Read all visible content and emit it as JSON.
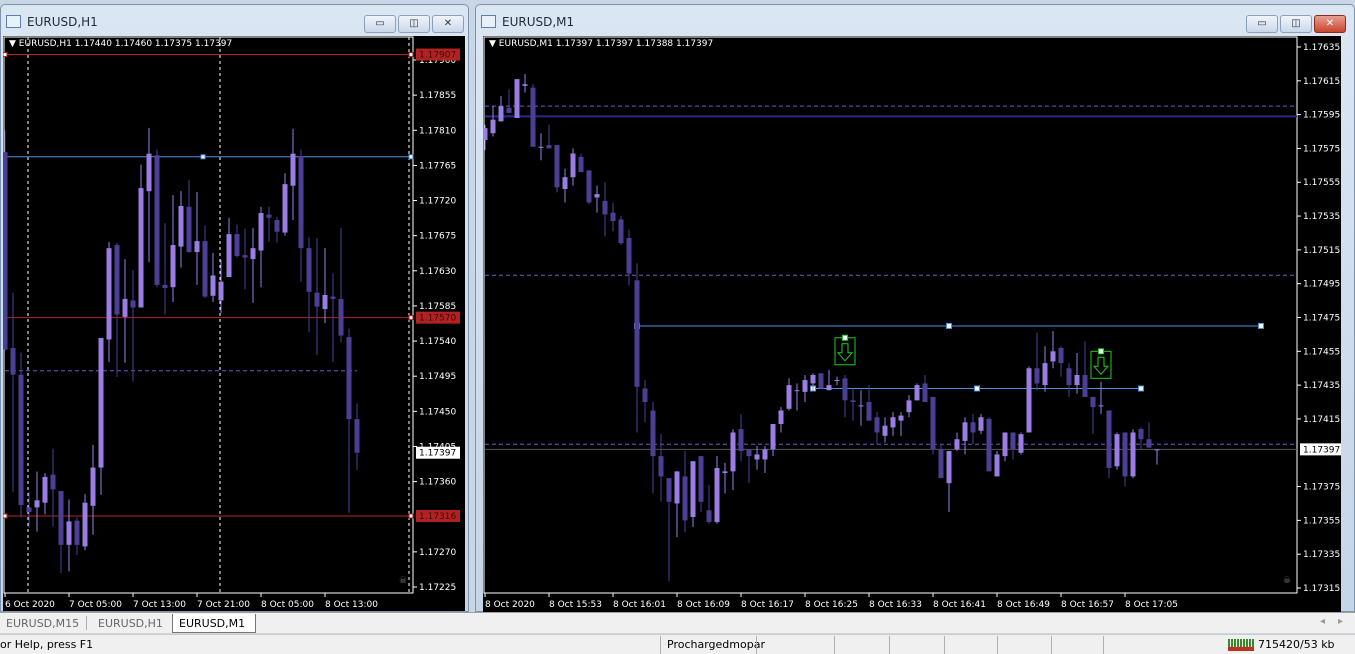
{
  "windows": {
    "left": {
      "title": "EURUSD,H1",
      "header": "EURUSD,H1  1.17440 1.17460 1.17375 1.17397"
    },
    "right": {
      "title": "EURUSD,M1",
      "header": "EURUSD,M1  1.17397 1.17397 1.17388 1.17397"
    },
    "buttons": {
      "minimize": "▭",
      "restore": "◫",
      "close": "✕"
    }
  },
  "tabs": [
    {
      "label": "EURUSD,M15",
      "active": false
    },
    {
      "label": "EURUSD,H1",
      "active": false
    },
    {
      "label": "EURUSD,M1",
      "active": true
    }
  ],
  "status": {
    "help": "or Help, press F1",
    "profile": "Prochargedmopar",
    "traffic": "715420/53 kb"
  },
  "colors": {
    "bull": "#9a7ee3",
    "bear": "#4b3f96",
    "red_line": "#b22222",
    "blue_line": "#4a90e2",
    "navy_line": "#2a2a8a",
    "dashed": "#6a5acd",
    "signal": "#22cc22"
  },
  "chart_data": [
    {
      "type": "candlestick",
      "title": "EURUSD,H1",
      "ylim": [
        1.17225,
        1.179
      ],
      "y_ticks": [
        "1.17900",
        "1.17855",
        "1.17810",
        "1.17765",
        "1.17720",
        "1.17675",
        "1.17630",
        "1.17585",
        "1.17540",
        "1.17495",
        "1.17450",
        "1.17405",
        "1.17360",
        "1.17270",
        "1.17225"
      ],
      "x_ticks": [
        "6 Oct 2020",
        "7 Oct 05:00",
        "7 Oct 13:00",
        "7 Oct 21:00",
        "8 Oct 05:00",
        "8 Oct 13:00"
      ],
      "price_tags": [
        {
          "value": "1.17907",
          "kind": "red"
        },
        {
          "value": "1.17570",
          "kind": "red"
        },
        {
          "value": "1.17316",
          "kind": "red"
        },
        {
          "value": "1.17397",
          "kind": "bid"
        }
      ],
      "hlines": [
        {
          "price": 1.17907,
          "color": "red"
        },
        {
          "price": 1.1757,
          "color": "red"
        },
        {
          "price": 1.17316,
          "color": "red"
        },
        {
          "price": 1.17776,
          "color": "blue"
        },
        {
          "price": 1.17502,
          "color": "dashed"
        }
      ],
      "ohlc": [
        [
          1.17782,
          1.1781,
          1.17528,
          1.17529
        ],
        [
          1.17531,
          1.17602,
          1.17347,
          1.17497
        ],
        [
          1.17497,
          1.17525,
          1.17314,
          1.1733
        ],
        [
          1.17327,
          1.17347,
          1.17301,
          1.17321
        ],
        [
          1.17327,
          1.17373,
          1.17296,
          1.17336
        ],
        [
          1.17333,
          1.17371,
          1.17318,
          1.17366
        ],
        [
          1.17369,
          1.17402,
          1.17302,
          1.1735
        ],
        [
          1.17348,
          1.17348,
          1.17243,
          1.17279
        ],
        [
          1.17279,
          1.17337,
          1.17245,
          1.17309
        ],
        [
          1.1731,
          1.17314,
          1.17266,
          1.17279
        ],
        [
          1.17277,
          1.17344,
          1.17272,
          1.17333
        ],
        [
          1.17329,
          1.17407,
          1.17292,
          1.17378
        ],
        [
          1.17378,
          1.17544,
          1.17343,
          1.17544
        ],
        [
          1.17542,
          1.17667,
          1.17513,
          1.17659
        ],
        [
          1.17663,
          1.17666,
          1.17494,
          1.17574
        ],
        [
          1.17571,
          1.17645,
          1.17512,
          1.17594
        ],
        [
          1.17592,
          1.17631,
          1.17488,
          1.17583
        ],
        [
          1.17583,
          1.17766,
          1.17583,
          1.17736
        ],
        [
          1.17732,
          1.17813,
          1.17641,
          1.1778
        ],
        [
          1.17778,
          1.17785,
          1.17609,
          1.17612
        ],
        [
          1.17612,
          1.17691,
          1.17574,
          1.17608
        ],
        [
          1.17609,
          1.17727,
          1.1759,
          1.17663
        ],
        [
          1.17661,
          1.17732,
          1.17634,
          1.17713
        ],
        [
          1.17712,
          1.17746,
          1.17653,
          1.17654
        ],
        [
          1.17654,
          1.17731,
          1.17612,
          1.17668
        ],
        [
          1.17668,
          1.17688,
          1.17595,
          1.17597
        ],
        [
          1.17598,
          1.17653,
          1.1759,
          1.17624
        ],
        [
          1.17592,
          1.17644,
          1.17576,
          1.17616
        ],
        [
          1.17622,
          1.17698,
          1.17622,
          1.17677
        ],
        [
          1.17677,
          1.17689,
          1.17647,
          1.17649
        ],
        [
          1.1765,
          1.17684,
          1.17606,
          1.17647
        ],
        [
          1.17645,
          1.17685,
          1.17589,
          1.17659
        ],
        [
          1.17656,
          1.17712,
          1.17609,
          1.17704
        ],
        [
          1.17702,
          1.17712,
          1.17667,
          1.17698
        ],
        [
          1.17695,
          1.17699,
          1.17666,
          1.1768
        ],
        [
          1.17679,
          1.17755,
          1.17675,
          1.17741
        ],
        [
          1.17739,
          1.17812,
          1.17695,
          1.1778
        ],
        [
          1.17777,
          1.17785,
          1.17616,
          1.17659
        ],
        [
          1.17659,
          1.17673,
          1.17552,
          1.17603
        ],
        [
          1.17602,
          1.17672,
          1.17522,
          1.17584
        ],
        [
          1.17581,
          1.17659,
          1.17563,
          1.17599
        ],
        [
          1.17597,
          1.17627,
          1.17513,
          1.17594
        ],
        [
          1.17594,
          1.17685,
          1.17538,
          1.17547
        ],
        [
          1.17545,
          1.17556,
          1.1732,
          1.1744
        ],
        [
          1.1744,
          1.1746,
          1.17375,
          1.17397
        ]
      ]
    },
    {
      "type": "candlestick",
      "title": "EURUSD,M1",
      "ylim": [
        1.17315,
        1.17635
      ],
      "y_ticks": [
        "1.17635",
        "1.17615",
        "1.17595",
        "1.17575",
        "1.17555",
        "1.17535",
        "1.17515",
        "1.17495",
        "1.17475",
        "1.17455",
        "1.17435",
        "1.17415",
        "1.17375",
        "1.17355",
        "1.17335",
        "1.17315"
      ],
      "x_ticks": [
        "8 Oct 2020",
        "8 Oct 15:53",
        "8 Oct 16:01",
        "8 Oct 16:09",
        "8 Oct 16:17",
        "8 Oct 16:25",
        "8 Oct 16:33",
        "8 Oct 16:41",
        "8 Oct 16:49",
        "8 Oct 16:57",
        "8 Oct 17:05"
      ],
      "price_tags": [
        {
          "value": "1.17397",
          "kind": "bid"
        }
      ],
      "hlines": [
        {
          "price": 1.176,
          "color": "dashed"
        },
        {
          "price": 1.17594,
          "color": "navy"
        },
        {
          "price": 1.175,
          "color": "dashed"
        },
        {
          "price": 1.174,
          "color": "dashed"
        },
        {
          "price": 1.17397,
          "color": "grey"
        }
      ],
      "trendlines": [
        {
          "from": "16:04",
          "to": "17:22",
          "price": 1.1747
        },
        {
          "from": "16:26",
          "to": "17:07",
          "price": 1.17433
        }
      ],
      "signals": [
        {
          "time": "16:30",
          "price": 1.17463,
          "direction": "sell"
        },
        {
          "time": "17:02",
          "price": 1.17455,
          "direction": "sell"
        }
      ],
      "ohlc": [
        [
          1.1758,
          1.17589,
          1.17574,
          1.17587
        ],
        [
          1.17584,
          1.176,
          1.17582,
          1.17592
        ],
        [
          1.17591,
          1.17606,
          1.17591,
          1.176
        ],
        [
          1.17599,
          1.1761,
          1.17596,
          1.17596
        ],
        [
          1.17593,
          1.17616,
          1.17593,
          1.17616
        ],
        [
          1.17612,
          1.17619,
          1.17608,
          1.17613
        ],
        [
          1.17611,
          1.17613,
          1.17576,
          1.17576
        ],
        [
          1.17576,
          1.17584,
          1.17568,
          1.17576
        ],
        [
          1.17577,
          1.17589,
          1.17575,
          1.17575
        ],
        [
          1.17577,
          1.17577,
          1.17549,
          1.17552
        ],
        [
          1.17551,
          1.17563,
          1.17543,
          1.17558
        ],
        [
          1.17558,
          1.17575,
          1.17553,
          1.17572
        ],
        [
          1.1757,
          1.17572,
          1.17561,
          1.17561
        ],
        [
          1.17562,
          1.17562,
          1.17542,
          1.17543
        ],
        [
          1.17546,
          1.17553,
          1.17537,
          1.17548
        ],
        [
          1.17544,
          1.17555,
          1.17523,
          1.17536
        ],
        [
          1.17537,
          1.17543,
          1.17526,
          1.17532
        ],
        [
          1.17533,
          1.17535,
          1.17518,
          1.17519
        ],
        [
          1.17522,
          1.17527,
          1.17494,
          1.17501
        ],
        [
          1.17497,
          1.17507,
          1.17407,
          1.17434
        ],
        [
          1.17433,
          1.17438,
          1.17413,
          1.17425
        ],
        [
          1.1742,
          1.17425,
          1.17371,
          1.17393
        ],
        [
          1.17393,
          1.17406,
          1.17366,
          1.17381
        ],
        [
          1.1738,
          1.1738,
          1.17319,
          1.17366
        ],
        [
          1.17365,
          1.17384,
          1.17345,
          1.17384
        ],
        [
          1.17381,
          1.17396,
          1.17348,
          1.17355
        ],
        [
          1.17357,
          1.1739,
          1.17351,
          1.1739
        ],
        [
          1.17393,
          1.17393,
          1.1736,
          1.17366
        ],
        [
          1.17361,
          1.17376,
          1.17353,
          1.17354
        ],
        [
          1.17354,
          1.17393,
          1.17353,
          1.17386
        ],
        [
          1.17383,
          1.17389,
          1.17371,
          1.17384
        ],
        [
          1.17384,
          1.17409,
          1.17373,
          1.17407
        ],
        [
          1.17409,
          1.17418,
          1.1739,
          1.17396
        ],
        [
          1.17397,
          1.17397,
          1.17377,
          1.17393
        ],
        [
          1.17391,
          1.17399,
          1.17385,
          1.17394
        ],
        [
          1.17391,
          1.17399,
          1.17383,
          1.17397
        ],
        [
          1.17397,
          1.17412,
          1.17393,
          1.17412
        ],
        [
          1.17412,
          1.17422,
          1.17407,
          1.1742
        ],
        [
          1.17421,
          1.17439,
          1.1742,
          1.17435
        ],
        [
          1.17432,
          1.17436,
          1.1742,
          1.17432
        ],
        [
          1.17431,
          1.17441,
          1.17425,
          1.17438
        ],
        [
          1.17436,
          1.17442,
          1.17432,
          1.17441
        ],
        [
          1.17442,
          1.17442,
          1.17433,
          1.17433
        ],
        [
          1.17432,
          1.17444,
          1.17432,
          1.17435
        ],
        [
          1.17438,
          1.1744,
          1.17435,
          1.17438
        ],
        [
          1.17439,
          1.17441,
          1.17416,
          1.17426
        ],
        [
          1.17426,
          1.17433,
          1.17414,
          1.17425
        ],
        [
          1.17423,
          1.17432,
          1.17411,
          1.17423
        ],
        [
          1.17425,
          1.17435,
          1.17414,
          1.17414
        ],
        [
          1.17416,
          1.17419,
          1.174,
          1.17407
        ],
        [
          1.17405,
          1.17416,
          1.17401,
          1.17411
        ],
        [
          1.1741,
          1.17419,
          1.17405,
          1.17416
        ],
        [
          1.17414,
          1.17419,
          1.17405,
          1.17417
        ],
        [
          1.17419,
          1.17429,
          1.17416,
          1.17426
        ],
        [
          1.17426,
          1.17436,
          1.17426,
          1.17435
        ],
        [
          1.17436,
          1.17441,
          1.17425,
          1.17425
        ],
        [
          1.17428,
          1.17428,
          1.17394,
          1.17397
        ],
        [
          1.17397,
          1.174,
          1.1738,
          1.1738
        ],
        [
          1.17377,
          1.17396,
          1.1736,
          1.17396
        ],
        [
          1.17397,
          1.17407,
          1.17396,
          1.17403
        ],
        [
          1.17402,
          1.17416,
          1.17394,
          1.17413
        ],
        [
          1.17413,
          1.17418,
          1.174,
          1.17407
        ],
        [
          1.17408,
          1.17418,
          1.17406,
          1.17416
        ],
        [
          1.17415,
          1.17416,
          1.17384,
          1.17384
        ],
        [
          1.17381,
          1.17396,
          1.17381,
          1.17394
        ],
        [
          1.17393,
          1.17407,
          1.1739,
          1.17407
        ],
        [
          1.17407,
          1.17407,
          1.17391,
          1.17397
        ],
        [
          1.17395,
          1.17407,
          1.17394,
          1.17406
        ],
        [
          1.17407,
          1.17446,
          1.17407,
          1.17445
        ],
        [
          1.17445,
          1.17466,
          1.17432,
          1.17436
        ],
        [
          1.17435,
          1.17458,
          1.17431,
          1.17448
        ],
        [
          1.17449,
          1.17467,
          1.17445,
          1.17455
        ],
        [
          1.17457,
          1.17458,
          1.1744,
          1.17448
        ],
        [
          1.17445,
          1.17448,
          1.17428,
          1.17435
        ],
        [
          1.17435,
          1.17454,
          1.1743,
          1.17441
        ],
        [
          1.17441,
          1.17461,
          1.17428,
          1.17428
        ],
        [
          1.17428,
          1.17428,
          1.17406,
          1.17422
        ],
        [
          1.17423,
          1.17437,
          1.17418,
          1.17423
        ],
        [
          1.1742,
          1.1742,
          1.1738,
          1.17386
        ],
        [
          1.17387,
          1.17407,
          1.17385,
          1.17406
        ],
        [
          1.17407,
          1.17407,
          1.17375,
          1.17381
        ],
        [
          1.17381,
          1.17409,
          1.1738,
          1.17407
        ],
        [
          1.17409,
          1.1741,
          1.17397,
          1.17403
        ],
        [
          1.17403,
          1.17413,
          1.17398,
          1.17398
        ],
        [
          1.17397,
          1.17397,
          1.17388,
          1.17397
        ]
      ]
    }
  ]
}
